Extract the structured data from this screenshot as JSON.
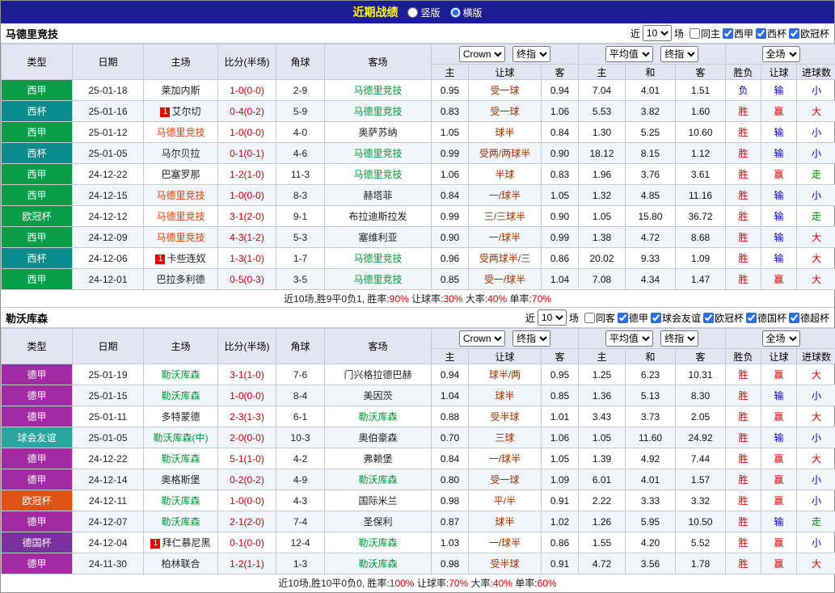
{
  "topbar": {
    "title": "近期战绩",
    "layout_options": [
      {
        "label": "竖版",
        "selected": false
      },
      {
        "label": "横版",
        "selected": true
      }
    ]
  },
  "header": {
    "static_cols": [
      "类型",
      "日期",
      "主场",
      "比分(半场)",
      "角球",
      "客场"
    ],
    "selects": {
      "odds_source": "Crown",
      "odds_time": "终指",
      "avg_source": "平均值",
      "avg_time": "终指",
      "result_scope": "全场"
    },
    "sub_cols": [
      "主",
      "让球",
      "客",
      "主",
      "和",
      "客",
      "胜负",
      "让球",
      "进球数"
    ]
  },
  "filter_labels": {
    "near": "近",
    "games": "场"
  },
  "palette": {
    "topbar_bg": "#1c1c94",
    "title_yellow": "#ffff00",
    "header_bg": "#e4e4f2",
    "grid": "#c3ccd6",
    "alt_row": "#f2f6fc",
    "score_red": "#cc0000",
    "handicap_red": "#993300",
    "res_red": "#e00000",
    "res_blue": "#0000cc",
    "res_green": "#008800",
    "team_red": "#e04000",
    "team_green": "#009933",
    "sum_red": "#e00000"
  },
  "tables": [
    {
      "team": "马德里竞技",
      "near": "10",
      "checkboxes": [
        {
          "label": "同主",
          "checked": false
        },
        {
          "label": "西甲",
          "checked": true
        },
        {
          "label": "西杯",
          "checked": true
        },
        {
          "label": "欧冠杯",
          "checked": true
        }
      ],
      "rows": [
        {
          "type": "西甲",
          "type_bg": "#0a9d47",
          "date": "25-01-18",
          "home": {
            "text": "莱加内斯"
          },
          "score": "1-0(0-0)",
          "corners": "2-9",
          "away": {
            "text": "马德里竞技",
            "color": "green"
          },
          "odds": [
            "0.95",
            "受一球",
            "0.94"
          ],
          "avg": [
            "7.04",
            "4.01",
            "1.51"
          ],
          "result": [
            "负",
            "输",
            "小"
          ]
        },
        {
          "type": "西杯",
          "type_bg": "#0b8c8c",
          "date": "25-01-16",
          "home": {
            "text": "艾尔切",
            "badge": "1"
          },
          "score": "0-4(0-2)",
          "corners": "5-9",
          "away": {
            "text": "马德里竞技",
            "color": "green"
          },
          "odds": [
            "0.83",
            "受一球",
            "1.06"
          ],
          "avg": [
            "5.53",
            "3.82",
            "1.60"
          ],
          "result": [
            "胜",
            "赢",
            "大"
          ]
        },
        {
          "type": "西甲",
          "type_bg": "#0a9d47",
          "date": "25-01-12",
          "home": {
            "text": "马德里竞技",
            "color": "red"
          },
          "score": "1-0(0-0)",
          "corners": "4-0",
          "away": {
            "text": "奥萨苏纳"
          },
          "odds": [
            "1.05",
            "球半",
            "0.84"
          ],
          "avg": [
            "1.30",
            "5.25",
            "10.60"
          ],
          "result": [
            "胜",
            "输",
            "小"
          ]
        },
        {
          "type": "西杯",
          "type_bg": "#0b8c8c",
          "date": "25-01-05",
          "home": {
            "text": "马尔贝拉"
          },
          "score": "0-1(0-1)",
          "corners": "4-6",
          "away": {
            "text": "马德里竞技",
            "color": "green"
          },
          "odds": [
            "0.99",
            "受两/两球半",
            "0.90"
          ],
          "avg": [
            "18.12",
            "8.15",
            "1.12"
          ],
          "result": [
            "胜",
            "输",
            "小"
          ]
        },
        {
          "type": "西甲",
          "type_bg": "#0a9d47",
          "date": "24-12-22",
          "home": {
            "text": "巴塞罗那"
          },
          "score": "1-2(1-0)",
          "corners": "11-3",
          "away": {
            "text": "马德里竞技",
            "color": "green"
          },
          "odds": [
            "1.06",
            "半球",
            "0.83"
          ],
          "avg": [
            "1.96",
            "3.76",
            "3.61"
          ],
          "result": [
            "胜",
            "赢",
            "走"
          ]
        },
        {
          "type": "西甲",
          "type_bg": "#0a9d47",
          "date": "24-12-15",
          "home": {
            "text": "马德里竞技",
            "color": "red"
          },
          "score": "1-0(0-0)",
          "corners": "8-3",
          "away": {
            "text": "赫塔菲"
          },
          "odds": [
            "0.84",
            "一/球半",
            "1.05"
          ],
          "avg": [
            "1.32",
            "4.85",
            "11.16"
          ],
          "result": [
            "胜",
            "输",
            "小"
          ]
        },
        {
          "type": "欧冠杯",
          "type_bg": "#0a9d47",
          "date": "24-12-12",
          "home": {
            "text": "马德里竞技",
            "color": "red"
          },
          "score": "3-1(2-0)",
          "corners": "9-1",
          "away": {
            "text": "布拉迪斯拉发"
          },
          "odds": [
            "0.99",
            "三/三球半",
            "0.90"
          ],
          "avg": [
            "1.05",
            "15.80",
            "36.72"
          ],
          "result": [
            "胜",
            "输",
            "走"
          ]
        },
        {
          "type": "西甲",
          "type_bg": "#0a9d47",
          "date": "24-12-09",
          "home": {
            "text": "马德里竞技",
            "color": "red"
          },
          "score": "4-3(1-2)",
          "corners": "5-3",
          "away": {
            "text": "塞维利亚"
          },
          "odds": [
            "0.90",
            "一/球半",
            "0.99"
          ],
          "avg": [
            "1.38",
            "4.72",
            "8.68"
          ],
          "result": [
            "胜",
            "输",
            "大"
          ]
        },
        {
          "type": "西杯",
          "type_bg": "#0b8c8c",
          "date": "24-12-06",
          "home": {
            "text": "卡些连奴",
            "badge": "1"
          },
          "score": "1-3(1-0)",
          "corners": "1-7",
          "away": {
            "text": "马德里竞技",
            "color": "green"
          },
          "odds": [
            "0.96",
            "受两球半/三",
            "0.86"
          ],
          "avg": [
            "20.02",
            "9.33",
            "1.09"
          ],
          "result": [
            "胜",
            "输",
            "大"
          ]
        },
        {
          "type": "西甲",
          "type_bg": "#0a9d47",
          "date": "24-12-01",
          "home": {
            "text": "巴拉多利德"
          },
          "score": "0-5(0-3)",
          "corners": "3-5",
          "away": {
            "text": "马德里竞技",
            "color": "green"
          },
          "odds": [
            "0.85",
            "受一/球半",
            "1.04"
          ],
          "avg": [
            "7.08",
            "4.34",
            "1.47"
          ],
          "result": [
            "胜",
            "赢",
            "大"
          ]
        }
      ],
      "summary": [
        {
          "t": "近10场,胜9平0负1, 胜率:"
        },
        {
          "t": "90%",
          "r": true
        },
        {
          "t": " 让球率:"
        },
        {
          "t": "30%",
          "r": true
        },
        {
          "t": " 大率:"
        },
        {
          "t": "40%",
          "r": true
        },
        {
          "t": " 单率:"
        },
        {
          "t": "70%",
          "r": true
        }
      ]
    },
    {
      "team": "勒沃库森",
      "near": "10",
      "checkboxes": [
        {
          "label": "同客",
          "checked": false
        },
        {
          "label": "德甲",
          "checked": true
        },
        {
          "label": "球会友谊",
          "checked": true
        },
        {
          "label": "欧冠杯",
          "checked": true
        },
        {
          "label": "德国杯",
          "checked": true
        },
        {
          "label": "德超杯",
          "checked": true
        }
      ],
      "rows": [
        {
          "type": "德甲",
          "type_bg": "#a32aa3",
          "date": "25-01-19",
          "home": {
            "text": "勒沃库森",
            "color": "green"
          },
          "score": "3-1(1-0)",
          "corners": "7-6",
          "away": {
            "text": "门兴格拉德巴赫"
          },
          "odds": [
            "0.94",
            "球半/两",
            "0.95"
          ],
          "avg": [
            "1.25",
            "6.23",
            "10.31"
          ],
          "result": [
            "胜",
            "赢",
            "大"
          ]
        },
        {
          "type": "德甲",
          "type_bg": "#a32aa3",
          "date": "25-01-15",
          "home": {
            "text": "勒沃库森",
            "color": "green"
          },
          "score": "1-0(0-0)",
          "corners": "8-4",
          "away": {
            "text": "美因茨"
          },
          "odds": [
            "1.04",
            "球半",
            "0.85"
          ],
          "avg": [
            "1.36",
            "5.13",
            "8.30"
          ],
          "result": [
            "胜",
            "输",
            "小"
          ]
        },
        {
          "type": "德甲",
          "type_bg": "#a32aa3",
          "date": "25-01-11",
          "home": {
            "text": "多特蒙德"
          },
          "score": "2-3(1-3)",
          "corners": "6-1",
          "away": {
            "text": "勒沃库森",
            "color": "green"
          },
          "odds": [
            "0.88",
            "受半球",
            "1.01"
          ],
          "avg": [
            "3.43",
            "3.73",
            "2.05"
          ],
          "result": [
            "胜",
            "赢",
            "大"
          ]
        },
        {
          "type": "球会友谊",
          "type_bg": "#28a7a0",
          "date": "25-01-05",
          "home": {
            "text": "勒沃库森(中)",
            "color": "green"
          },
          "score": "2-0(0-0)",
          "corners": "10-3",
          "away": {
            "text": "奥伯豪森"
          },
          "odds": [
            "0.70",
            "三球",
            "1.06"
          ],
          "avg": [
            "1.05",
            "11.60",
            "24.92"
          ],
          "result": [
            "胜",
            "输",
            "小"
          ]
        },
        {
          "type": "德甲",
          "type_bg": "#a32aa3",
          "date": "24-12-22",
          "home": {
            "text": "勒沃库森",
            "color": "green"
          },
          "score": "5-1(1-0)",
          "corners": "4-2",
          "away": {
            "text": "弗赖堡"
          },
          "odds": [
            "0.84",
            "一/球半",
            "1.05"
          ],
          "avg": [
            "1.39",
            "4.92",
            "7.44"
          ],
          "result": [
            "胜",
            "赢",
            "大"
          ]
        },
        {
          "type": "德甲",
          "type_bg": "#a32aa3",
          "date": "24-12-14",
          "home": {
            "text": "奥格斯堡"
          },
          "score": "0-2(0-2)",
          "corners": "4-9",
          "away": {
            "text": "勒沃库森",
            "color": "green"
          },
          "odds": [
            "0.80",
            "受一球",
            "1.09"
          ],
          "avg": [
            "6.01",
            "4.01",
            "1.57"
          ],
          "result": [
            "胜",
            "赢",
            "小"
          ]
        },
        {
          "type": "欧冠杯",
          "type_bg": "#de5117",
          "date": "24-12-11",
          "home": {
            "text": "勒沃库森",
            "color": "green"
          },
          "score": "1-0(0-0)",
          "corners": "4-3",
          "away": {
            "text": "国际米兰"
          },
          "odds": [
            "0.98",
            "平/半",
            "0.91"
          ],
          "avg": [
            "2.22",
            "3.33",
            "3.32"
          ],
          "result": [
            "胜",
            "赢",
            "小"
          ]
        },
        {
          "type": "德甲",
          "type_bg": "#a32aa3",
          "date": "24-12-07",
          "home": {
            "text": "勒沃库森",
            "color": "green"
          },
          "score": "2-1(2-0)",
          "corners": "7-4",
          "away": {
            "text": "圣保利"
          },
          "odds": [
            "0.87",
            "球半",
            "1.02"
          ],
          "avg": [
            "1.26",
            "5.95",
            "10.50"
          ],
          "result": [
            "胜",
            "输",
            "走"
          ]
        },
        {
          "type": "德国杯",
          "type_bg": "#7c2f9e",
          "date": "24-12-04",
          "home": {
            "text": "拜仁慕尼黑",
            "badge": "1"
          },
          "score": "0-1(0-0)",
          "corners": "12-4",
          "away": {
            "text": "勒沃库森",
            "color": "green"
          },
          "odds": [
            "1.03",
            "一/球半",
            "0.86"
          ],
          "avg": [
            "1.55",
            "4.20",
            "5.52"
          ],
          "result": [
            "胜",
            "赢",
            "小"
          ]
        },
        {
          "type": "德甲",
          "type_bg": "#a32aa3",
          "date": "24-11-30",
          "home": {
            "text": "柏林联合"
          },
          "score": "1-2(1-1)",
          "corners": "1-3",
          "away": {
            "text": "勒沃库森",
            "color": "green"
          },
          "odds": [
            "0.98",
            "受半球",
            "0.91"
          ],
          "avg": [
            "4.72",
            "3.56",
            "1.78"
          ],
          "result": [
            "胜",
            "赢",
            "大"
          ]
        }
      ],
      "summary": [
        {
          "t": "近10场,胜10平0负0, 胜率:"
        },
        {
          "t": "100%",
          "r": true
        },
        {
          "t": " 让球率:"
        },
        {
          "t": "70%",
          "r": true
        },
        {
          "t": " 大率:"
        },
        {
          "t": "40%",
          "r": true
        },
        {
          "t": " 单率:"
        },
        {
          "t": "60%",
          "r": true
        }
      ]
    }
  ]
}
